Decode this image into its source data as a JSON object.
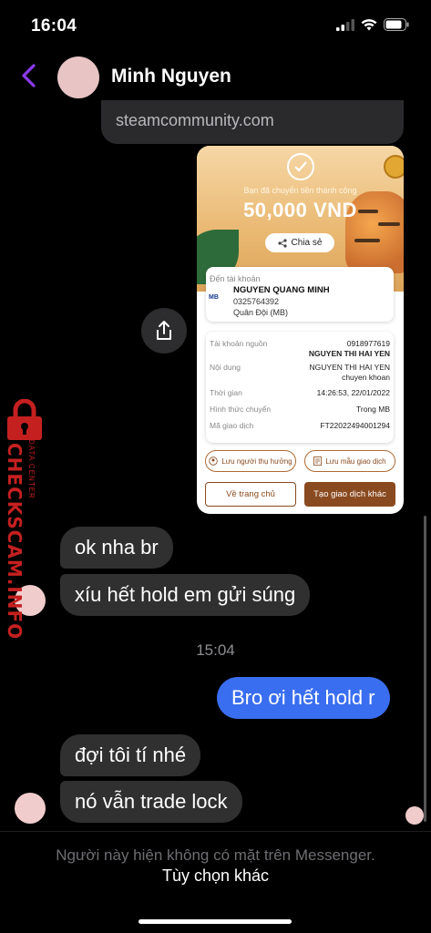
{
  "status": {
    "time": "16:04"
  },
  "header": {
    "contact_name": "Minh Nguyen"
  },
  "link_preview": {
    "domain": "steamcommunity.com"
  },
  "receipt": {
    "success_text": "Bạn đã chuyển tiền thành công",
    "amount": "50,000 VND",
    "share_label": "Chia sẻ",
    "to_label": "Đến tài khoản",
    "bank_logo": "MB",
    "to_name": "NGUYEN QUANG MINH",
    "to_phone": "0325764392",
    "to_bank": "Quân Đội (MB)",
    "rows": [
      {
        "label": "Tài khoản nguồn",
        "value": "0918977619",
        "value2": "NGUYEN THI HAI YEN"
      },
      {
        "label": "Nội dung",
        "value": "NGUYEN THI HAI YEN",
        "value2": "chuyen khoan"
      },
      {
        "label": "Thời gian",
        "value": "14:26:53, 22/01/2022"
      },
      {
        "label": "Hình thức chuyển",
        "value": "Trong MB"
      },
      {
        "label": "Mã giao dịch",
        "value": "FT22022494001294"
      }
    ],
    "save_recipient": "Lưu người thụ hưởng",
    "save_template": "Lưu mẫu giao dịch",
    "home_btn": "Về trang chủ",
    "new_txn_btn": "Tạo giao dịch khác"
  },
  "watermark": {
    "brand": "CHECKSCAM.INFO",
    "sub": "DATA CENTER"
  },
  "messages": {
    "m1": "ok nha br",
    "m2": "xíu hết hold em gửi súng",
    "time_sep": "15:04",
    "m3": "Bro ơi hết hold r",
    "m4": "đợi tôi tí nhé",
    "m5": "nó vẫn trade lock"
  },
  "footer": {
    "note": "Người này hiện không có mặt trên Messenger.",
    "link": "Tùy chọn khác"
  },
  "colors": {
    "accent": "#3a6ef0",
    "back": "#8b3bf0",
    "brown": "#8a4a1f"
  }
}
